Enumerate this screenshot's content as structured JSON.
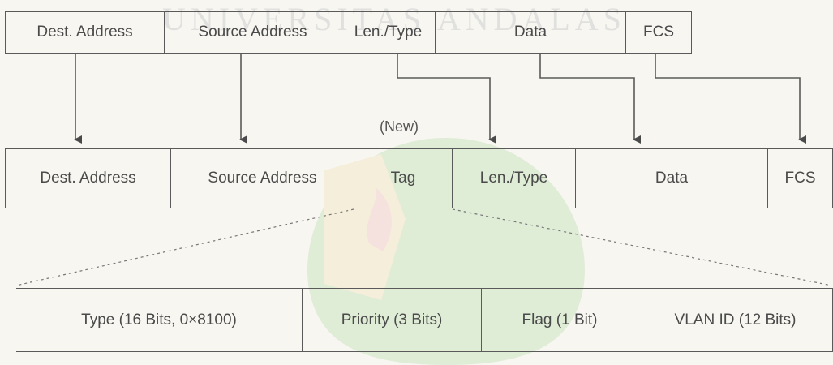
{
  "frame_original": {
    "fields": [
      "Dest. Address",
      "Source Address",
      "Len./Type",
      "Data",
      "FCS"
    ]
  },
  "frame_tagged": {
    "new_label": "(New)",
    "fields": [
      "Dest. Address",
      "Source Address",
      "Tag",
      "Len./Type",
      "Data",
      "FCS"
    ]
  },
  "tag_detail": {
    "fields": [
      "Type (16 Bits, 0×8100)",
      "Priority (3 Bits)",
      "Flag (1 Bit)",
      "VLAN ID (12 Bits)"
    ]
  },
  "watermark": {
    "text": "UNIVERSITAS ANDALAS"
  },
  "colors": {
    "line": "#5a5a5a",
    "background": "#f7f6f1",
    "watermark_green": "#9bd18a",
    "watermark_yellow": "#f1d79a",
    "watermark_red": "#f2a7a7"
  }
}
